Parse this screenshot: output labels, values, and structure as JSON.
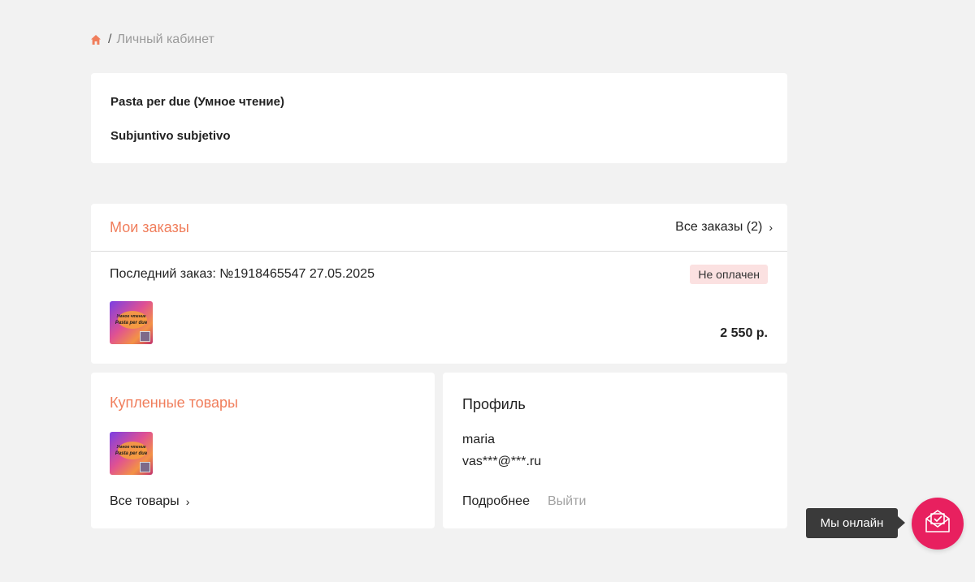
{
  "breadcrumb": {
    "home_icon": "home-icon",
    "separator": "/",
    "current": "Личный кабинет"
  },
  "courses": [
    "Pasta per due (Умное чтение)",
    "Subjuntivo subjetivo"
  ],
  "orders": {
    "title": "Мои заказы",
    "all_link": "Все заказы (2)",
    "last_order_text": "Последний заказ: №1918465547 27.05.2025",
    "status": "Не оплачен",
    "price": "2 550 р.",
    "chevron": "›"
  },
  "thumbnail": {
    "line1": "Умное чтение",
    "line2": "Pasta per due"
  },
  "purchased": {
    "title": "Купленные товары",
    "all_link": "Все товары",
    "chevron": "›"
  },
  "profile": {
    "title": "Профиль",
    "name": "maria",
    "email": "vas***@***.ru",
    "more": "Подробнее",
    "logout": "Выйти"
  },
  "chat": {
    "tooltip": "Мы онлайн",
    "icon": "envelope-icon"
  },
  "colors": {
    "accent": "#f07e5c",
    "chat": "#e8205f",
    "badge_bg": "#fbe1e1",
    "background": "#f2f2f2"
  }
}
